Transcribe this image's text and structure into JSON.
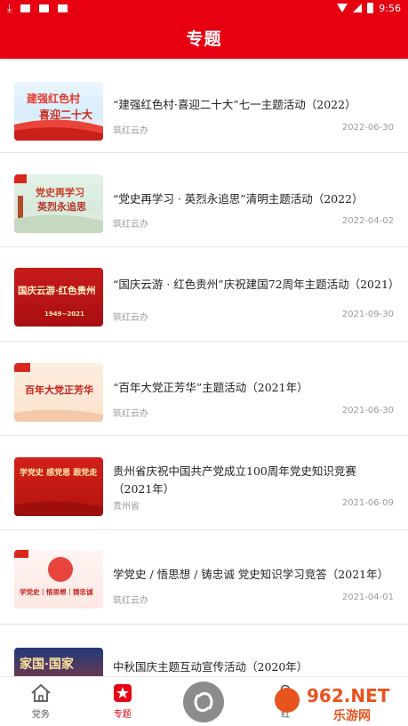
{
  "status_bar": {
    "time": "9:56",
    "icons": [
      "download-icon",
      "mail-icon",
      "mail-icon",
      "app-icon"
    ],
    "right_icons": [
      "wifi-icon",
      "signal-icon",
      "battery-icon"
    ]
  },
  "header": {
    "title": "专题"
  },
  "topics": [
    {
      "title": "“建强红色村·喜迎二十大”七一主题活动（2022）",
      "source": "筑红云办",
      "date": "2022-06-30",
      "thumb": {
        "line1": "建强红色村",
        "line2": "喜迎二十大"
      }
    },
    {
      "title": "“党史再学习 · 英烈永追思”清明主题活动（2022）",
      "source": "筑红云办",
      "date": "2022-04-02",
      "thumb": {
        "line1": "党史再学习",
        "line2": "英烈永追思"
      }
    },
    {
      "title": "“国庆云游 · 红色贵州”庆祝建国72周年主题活动（2021）",
      "source": "筑红云办",
      "date": "2021-09-30",
      "thumb": {
        "line1": "国庆云游·红色贵州",
        "line2": "1949~2021"
      }
    },
    {
      "title": "“百年大党正芳华”主题活动（2021年）",
      "source": "筑红云办",
      "date": "2021-06-30",
      "thumb": {
        "line1": "百年大党正芳华",
        "line2": ""
      }
    },
    {
      "title": "贵州省庆祝中国共产党成立100周年党史知识竞赛（2021年）",
      "source": "贵州省",
      "date": "2021-06-09",
      "thumb": {
        "line1": "学党史 感党恩 跟党走",
        "line2": ""
      }
    },
    {
      "title": "学党史 / 悟思想 / 铸忠诚 党史知识学习竞答（2021年）",
      "source": "筑红云办",
      "date": "2021-04-01",
      "thumb": {
        "line1": "学党史｜悟思想｜铸忠诚",
        "line2": ""
      }
    },
    {
      "title": "中秋国庆主题互动宣传活动（2020年）",
      "source": "",
      "date": "",
      "thumb": {
        "line1": "家国·国家",
        "line2": ""
      }
    }
  ],
  "tabbar": {
    "tabs": [
      {
        "label": "党务",
        "icon": "home-icon"
      },
      {
        "label": "专题",
        "icon": "star-badge-icon"
      },
      {
        "label": "",
        "icon": "center-logo-icon"
      },
      {
        "label": "红",
        "icon": "person-icon"
      }
    ]
  },
  "watermark": {
    "text": "962.NET",
    "subtext": "乐游网"
  },
  "colors": {
    "brand_red": "#e60012",
    "muted_text": "#9a9a9a"
  }
}
